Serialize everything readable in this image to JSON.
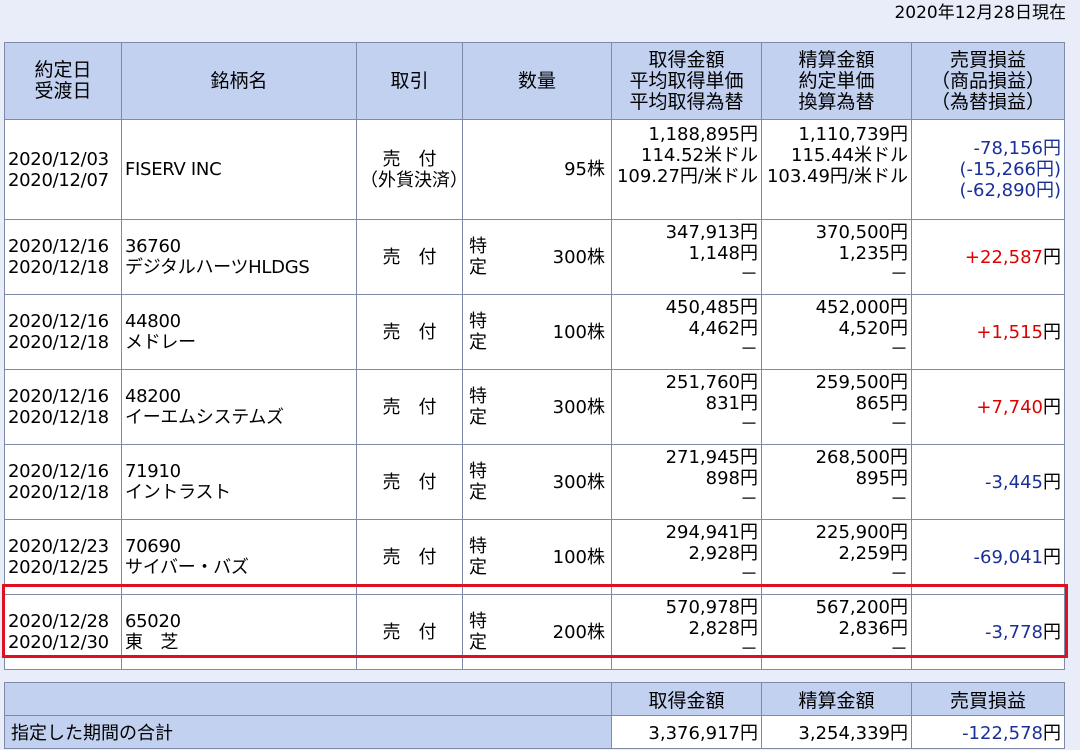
{
  "as_of": "2020年12月28日現在",
  "headers": {
    "date": [
      "約定日",
      "受渡日"
    ],
    "name": "銘柄名",
    "trade": "取引",
    "quantity": "数量",
    "acquisition": [
      "取得金額",
      "平均取得単価",
      "平均取得為替"
    ],
    "settlement": [
      "精算金額",
      "約定単価",
      "換算為替"
    ],
    "pl": [
      "売買損益",
      "（商品損益）",
      "（為替損益）"
    ]
  },
  "rows": [
    {
      "trade_date": "2020/12/03",
      "delivery_date": "2020/12/07",
      "code": "",
      "name": "FISERV INC",
      "trade": "売　付",
      "trade_note": "（外貨決済）",
      "account": "",
      "quantity": "95株",
      "acq_amount": "1,188,895円",
      "acq_unit": "114.52米ドル",
      "acq_fx": "109.27円/米ドル",
      "set_amount": "1,110,739円",
      "set_unit": "115.44米ドル",
      "set_fx": "103.49円/米ドル",
      "pl": "-78,156円",
      "pl_product": "(-15,266円)",
      "pl_fx": "(-62,890円)",
      "pl_sign": "neg"
    },
    {
      "trade_date": "2020/12/16",
      "delivery_date": "2020/12/18",
      "code": "36760",
      "name": "デジタルハーツHLDGS",
      "trade": "売　付",
      "account": "特定",
      "quantity": "300株",
      "acq_amount": "347,913円",
      "acq_unit": "1,148円",
      "acq_fx": "－",
      "set_amount": "370,500円",
      "set_unit": "1,235円",
      "set_fx": "－",
      "pl_value": "+22,587",
      "pl_unit": "円",
      "pl_sign": "pos"
    },
    {
      "trade_date": "2020/12/16",
      "delivery_date": "2020/12/18",
      "code": "44800",
      "name": "メドレー",
      "trade": "売　付",
      "account": "特定",
      "quantity": "100株",
      "acq_amount": "450,485円",
      "acq_unit": "4,462円",
      "acq_fx": "－",
      "set_amount": "452,000円",
      "set_unit": "4,520円",
      "set_fx": "－",
      "pl_value": "+1,515",
      "pl_unit": "円",
      "pl_sign": "pos"
    },
    {
      "trade_date": "2020/12/16",
      "delivery_date": "2020/12/18",
      "code": "48200",
      "name": "イーエムシステムズ",
      "trade": "売　付",
      "account": "特定",
      "quantity": "300株",
      "acq_amount": "251,760円",
      "acq_unit": "831円",
      "acq_fx": "－",
      "set_amount": "259,500円",
      "set_unit": "865円",
      "set_fx": "－",
      "pl_value": "+7,740",
      "pl_unit": "円",
      "pl_sign": "pos"
    },
    {
      "trade_date": "2020/12/16",
      "delivery_date": "2020/12/18",
      "code": "71910",
      "name": "イントラスト",
      "trade": "売　付",
      "account": "特定",
      "quantity": "300株",
      "acq_amount": "271,945円",
      "acq_unit": "898円",
      "acq_fx": "－",
      "set_amount": "268,500円",
      "set_unit": "895円",
      "set_fx": "－",
      "pl_value": "-3,445",
      "pl_unit": "円",
      "pl_sign": "neg"
    },
    {
      "trade_date": "2020/12/23",
      "delivery_date": "2020/12/25",
      "code": "70690",
      "name": "サイバー・バズ",
      "trade": "売　付",
      "account": "特定",
      "quantity": "100株",
      "acq_amount": "294,941円",
      "acq_unit": "2,928円",
      "acq_fx": "－",
      "set_amount": "225,900円",
      "set_unit": "2,259円",
      "set_fx": "－",
      "pl_value": "-69,041",
      "pl_unit": "円",
      "pl_sign": "neg"
    },
    {
      "trade_date": "2020/12/28",
      "delivery_date": "2020/12/30",
      "code": "65020",
      "name": "東　芝",
      "trade": "売　付",
      "account": "特定",
      "quantity": "200株",
      "acq_amount": "570,978円",
      "acq_unit": "2,828円",
      "acq_fx": "－",
      "set_amount": "567,200円",
      "set_unit": "2,836円",
      "set_fx": "－",
      "pl_value": "-3,778",
      "pl_unit": "円",
      "pl_sign": "neg"
    }
  ],
  "summary": {
    "headers": [
      "取得金額",
      "精算金額",
      "売買損益"
    ],
    "label": "指定した期間の合計",
    "acquisition": "3,376,917円",
    "settlement": "3,254,339円",
    "pl_value": "-122,578",
    "pl_unit": "円"
  },
  "colors": {
    "header_bg": "#c2d1ef",
    "page_bg": "#e8edf9",
    "positive": "#e00000",
    "negative": "#1a2f9a",
    "highlight_border": "#e01020"
  }
}
